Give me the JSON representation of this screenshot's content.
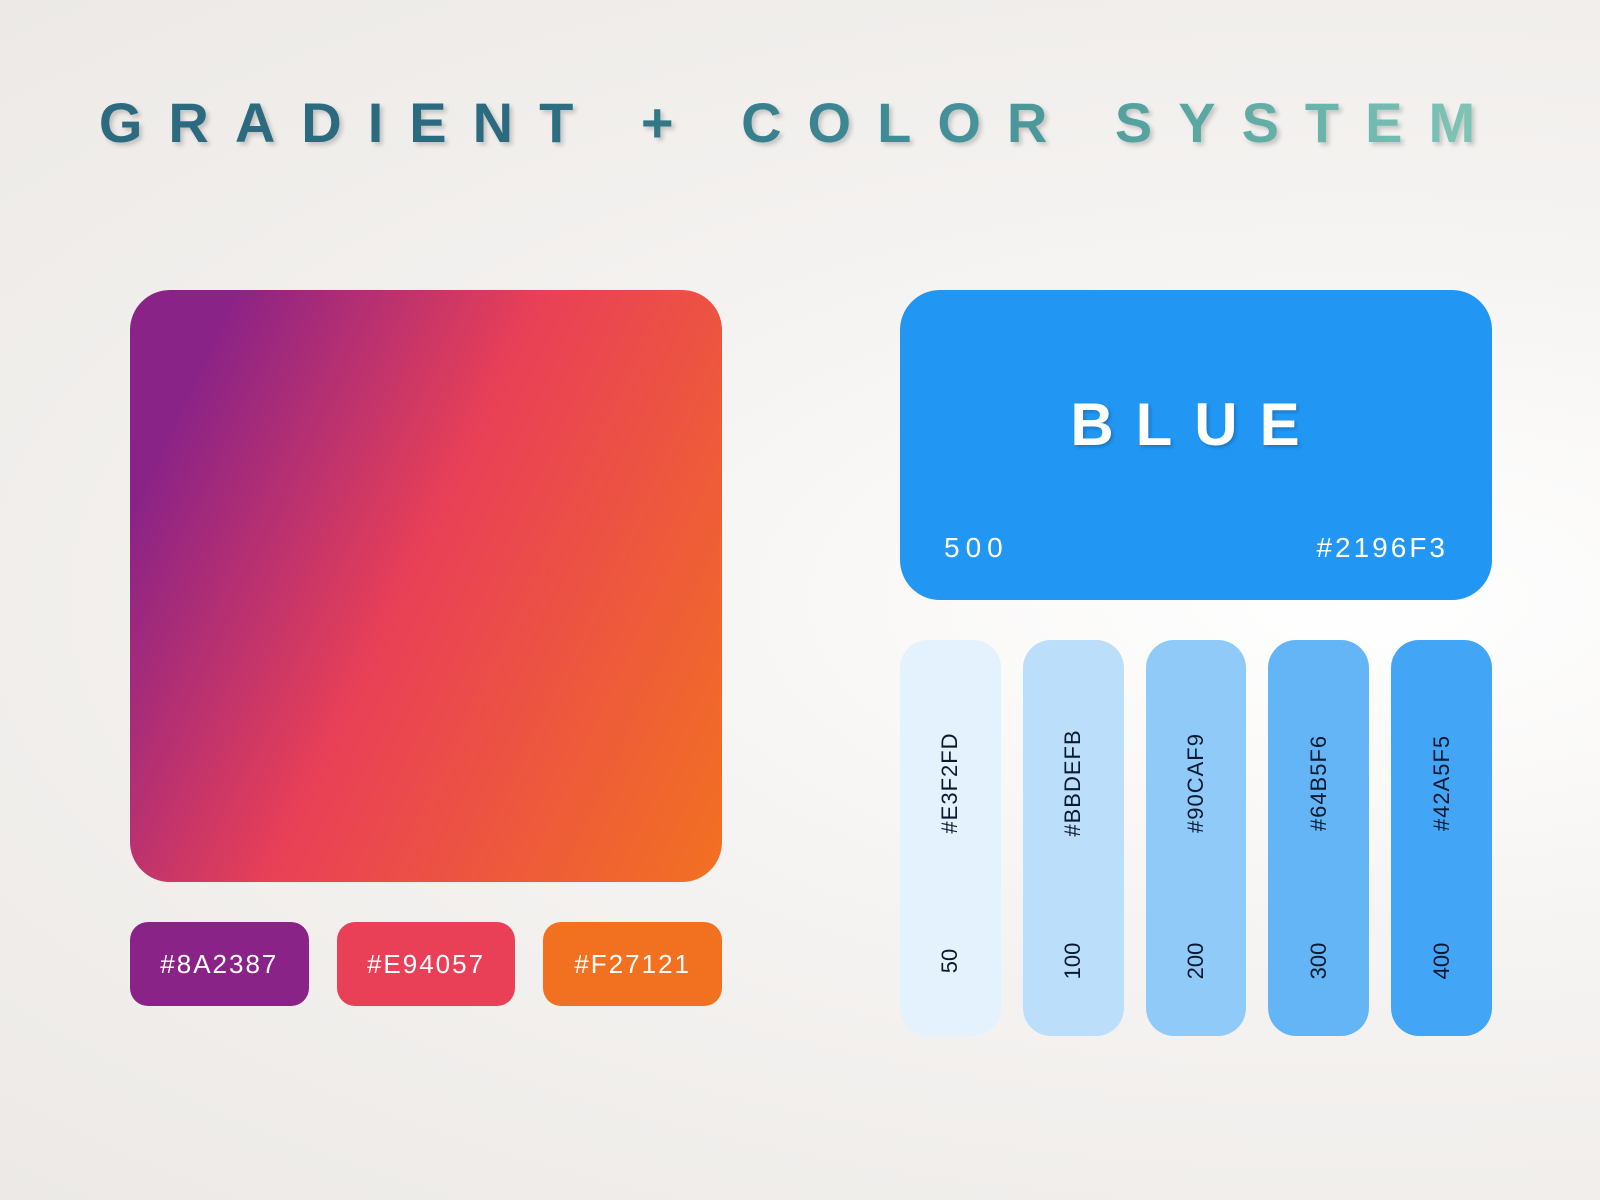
{
  "title": "GRADIENT + COLOR SYSTEM",
  "gradient": {
    "stops": [
      {
        "hex": "#8A2387"
      },
      {
        "hex": "#E94057"
      },
      {
        "hex": "#F27121"
      }
    ]
  },
  "color_system": {
    "name": "BLUE",
    "main": {
      "shade": "500",
      "hex": "#2196F3"
    },
    "shades": [
      {
        "shade": "50",
        "hex": "#E3F2FD"
      },
      {
        "shade": "100",
        "hex": "#BBDEFB"
      },
      {
        "shade": "200",
        "hex": "#90CAF9"
      },
      {
        "shade": "300",
        "hex": "#64B5F6"
      },
      {
        "shade": "400",
        "hex": "#42A5F5"
      }
    ]
  }
}
